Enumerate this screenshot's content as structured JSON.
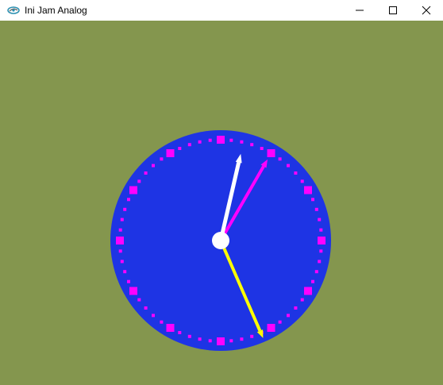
{
  "window": {
    "title": "Ini Jam Analog",
    "icon": "app-logo-icon",
    "controls": [
      {
        "name": "minimize-button",
        "icon": "minimize-icon"
      },
      {
        "name": "maximize-button",
        "icon": "maximize-icon"
      },
      {
        "name": "close-button",
        "icon": "close-icon"
      }
    ]
  },
  "colors": {
    "background": "#84964E",
    "face": "#1E34E4",
    "markers": "#FF00FF",
    "hour_hand": "#FFFFFF",
    "minute_hand": "#FFFF00",
    "second_hand": "#FF00FF",
    "hub": "#FFFFFF"
  },
  "clock": {
    "hour": 12,
    "minute": 26,
    "second": 5
  }
}
